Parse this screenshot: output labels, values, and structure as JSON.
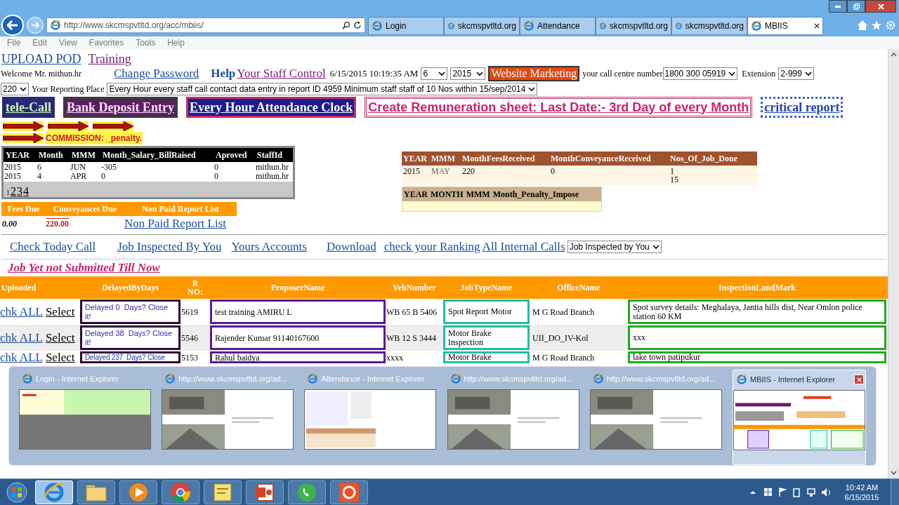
{
  "browser": {
    "address": "http://www.skcmspvtltd.org/acc/mbiis/",
    "tabs": [
      {
        "label": "Login",
        "selected": false
      },
      {
        "label": "skcmspvtltd.org",
        "selected": false
      },
      {
        "label": "Attendance",
        "selected": false
      },
      {
        "label": "skcmspvtltd.org",
        "selected": false
      },
      {
        "label": "skcmspvtltd.org",
        "selected": false
      },
      {
        "label": "MBIIS",
        "selected": true
      }
    ],
    "menu": [
      "File",
      "Edit",
      "View",
      "Favorites",
      "Tools",
      "Help"
    ]
  },
  "header": {
    "links": [
      "UPLOAD POD",
      "Training"
    ],
    "welcome": "Welcome Mr. mithun.hr",
    "account_links": [
      {
        "label": "Change Password",
        "kind": "plain"
      },
      {
        "label": "Help",
        "kind": "bold"
      },
      {
        "label": "Your Staff Control",
        "kind": "visited"
      }
    ],
    "datetime": "6/15/2015 10:19:35 AM",
    "month_select": "6",
    "year_select": "2015",
    "marketing_button": "Website Marketing",
    "call_centre_label": "your call centre number",
    "call_centre_select": "1800 300 05919",
    "extension_label": "Extension",
    "extension_select": "2-999"
  },
  "reporting": {
    "select": "220",
    "label": "Your Reporting Place",
    "place_select": "Every Hour every staff call contact data entry in report ID 4959 Minimum staff staff of 10 Nos within 15/sep/2014"
  },
  "action_buttons": [
    {
      "label": "tele-Call",
      "kind": "tele"
    },
    {
      "label": "Bank Deposit Entry",
      "kind": "bank"
    },
    {
      "label": "Every Hour Attendance Clock",
      "kind": "clock"
    },
    {
      "label": "Create Remuneration sheet: Last Date:- 3rd Day of every Month",
      "kind": "remuneration"
    },
    {
      "label": "critical report",
      "kind": "dotted"
    }
  ],
  "commission": "COMMISSION: _penalty.",
  "salary_table": {
    "columns": [
      "YEAR",
      "Month",
      "MMM",
      "Month_Salary_BillRaised",
      "Aproved",
      "StaffId"
    ],
    "rows": [
      [
        "2015",
        "6",
        "JUN",
        "-305",
        "0",
        "mithun.hr"
      ],
      [
        "2015",
        "4",
        "APR",
        "0",
        "0",
        "mithun.hr"
      ]
    ]
  },
  "pager": [
    {
      "label": "1",
      "selected": true
    },
    {
      "label": "2",
      "selected": false
    },
    {
      "label": "3",
      "selected": false
    },
    {
      "label": "4",
      "selected": false
    }
  ],
  "dues_table": {
    "columns": [
      "Fees Due",
      "Conveyances Due",
      "Non Paid Report List"
    ],
    "fees": "0.00",
    "conveyances": "220.00",
    "link": "Non Paid Report List"
  },
  "fees_table": {
    "columns": [
      "YEAR",
      "MMM",
      "MonthFeesReceived",
      "MonthConveyanceReceived",
      "Nos_Of_Job_Done"
    ],
    "rows": [
      [
        "2015",
        "MAY",
        "220",
        "0",
        [
          "1",
          "15"
        ]
      ]
    ]
  },
  "penalty_table": {
    "columns": [
      "YEAR",
      "MONTH",
      "MMM",
      "Month_Penalty_Impose"
    ]
  },
  "nav_links": [
    "Check Today Call",
    "Job Inspected By You",
    "Yours Accounts",
    "Download",
    "check your Ranking",
    "All Internal Calls"
  ],
  "nav_select": "Job Inspected by You",
  "jobs": {
    "title": "Job Yet not Submitted Till Now",
    "columns": [
      "Uploaded",
      "DelayedByDays",
      "R NO:",
      "ProposerName",
      "VehNumber",
      "JobTypeName",
      "OfficeName",
      "InspectionLandMark"
    ],
    "rows": [
      {
        "check": "chk ALL",
        "select": "Select",
        "delay": "Delayed 0  Days? Close it!",
        "r_no": "5619",
        "proposer": "test training AMIRU L",
        "veh": "WB 65 B 5406",
        "job_type": "Spot Report Motor",
        "office": "M G Road Branch",
        "landmark": "Spot survey details: Meghalaya, Jantia hills dist, Near Omlon police station 60 KM"
      },
      {
        "check": "chk ALL",
        "select": "Select",
        "delay": "Delayed 38  Days? Close it!",
        "r_no": "5546",
        "proposer": "Rajender Kumar 91140167600",
        "veh": "WB 12 S 3444",
        "job_type": "Motor Brake Inspection",
        "office": "UII_DO_IV-Kol",
        "landmark": "xxx"
      },
      {
        "check": "chk ALL",
        "select": "Select",
        "delay": "Delayed 237  Days? Close",
        "r_no": "5153",
        "proposer": "Rahul baidya",
        "veh": "xxxx",
        "job_type": "Motor Brake",
        "office": "M G Road Branch",
        "landmark": "lake town patipukur"
      }
    ]
  },
  "switcher": [
    {
      "title": "Login - Internet Explorer",
      "kind": "login",
      "selected": false
    },
    {
      "title": "http://www.skcmspvtltd.org/ad...",
      "kind": "photos",
      "selected": false
    },
    {
      "title": "Attendance - Internet Explorer",
      "kind": "list",
      "selected": false
    },
    {
      "title": "http://www.skcmspvtltd.org/ad...",
      "kind": "photos",
      "selected": false
    },
    {
      "title": "http://www.skcmspvtltd.org/ad...",
      "kind": "photos",
      "selected": false
    },
    {
      "title": "MBIIS - Internet Explorer",
      "kind": "page",
      "selected": true
    }
  ],
  "taskbar": {
    "apps": [
      {
        "kind": "ie",
        "selected": true
      },
      {
        "kind": "folder",
        "selected": false
      },
      {
        "kind": "media",
        "selected": false
      },
      {
        "kind": "chrome",
        "selected": false
      },
      {
        "kind": "sticky",
        "selected": false
      },
      {
        "kind": "slides",
        "selected": false
      },
      {
        "kind": "phone",
        "selected": false
      },
      {
        "kind": "camera",
        "selected": false
      }
    ],
    "time": "10:42 AM",
    "date": "6/15/2015"
  }
}
